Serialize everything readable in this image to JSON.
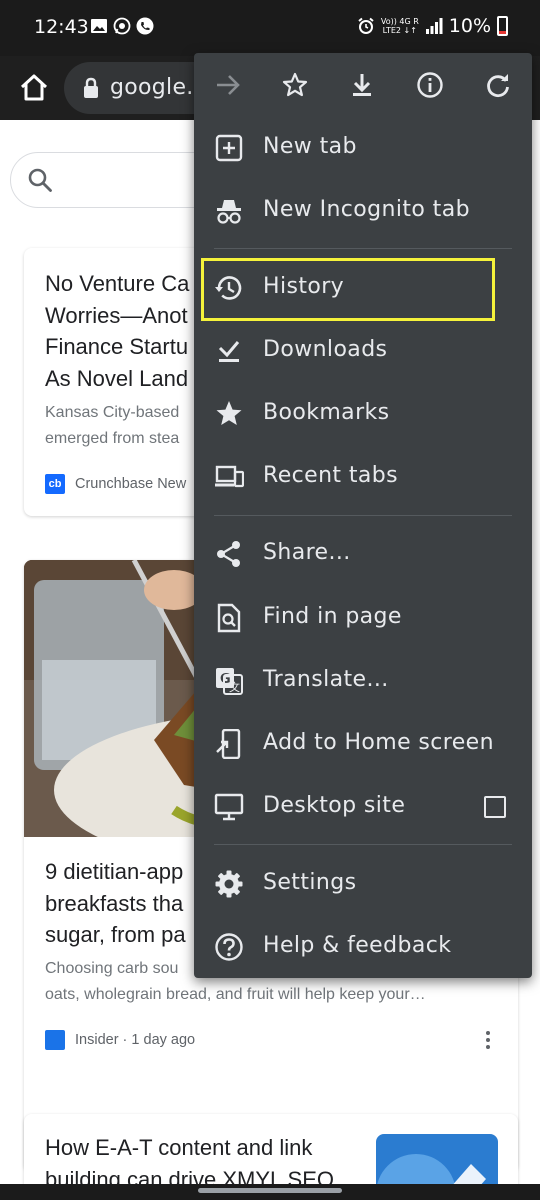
{
  "status_bar": {
    "time": "12:43",
    "network_line1": "Vo)) 4G R",
    "network_line2": "LTE2 ↓↑",
    "battery": "10%",
    "battery_color": "#e53935"
  },
  "toolbar": {
    "url": "google.c"
  },
  "menu": {
    "top_icons": [
      "forward-icon",
      "bookmark-star-icon",
      "download-icon",
      "info-icon",
      "reload-icon"
    ],
    "items": [
      {
        "label": "New tab",
        "icon": "new-tab-icon"
      },
      {
        "label": "New Incognito tab",
        "icon": "incognito-icon"
      },
      {
        "label": "History",
        "icon": "history-icon",
        "highlighted": true
      },
      {
        "label": "Downloads",
        "icon": "downloads-icon"
      },
      {
        "label": "Bookmarks",
        "icon": "bookmarks-icon"
      },
      {
        "label": "Recent tabs",
        "icon": "recent-tabs-icon"
      },
      {
        "label": "Share...",
        "icon": "share-icon"
      },
      {
        "label": "Find in page",
        "icon": "find-in-page-icon"
      },
      {
        "label": "Translate...",
        "icon": "translate-icon"
      },
      {
        "label": "Add to Home screen",
        "icon": "add-to-home-icon"
      },
      {
        "label": "Desktop site",
        "icon": "desktop-icon",
        "checked": false
      },
      {
        "label": "Settings",
        "icon": "settings-icon"
      },
      {
        "label": "Help & feedback",
        "icon": "help-icon"
      }
    ],
    "highlight_color": "#f5f23b"
  },
  "feed": {
    "cards": [
      {
        "title": "No Venture Ca\nWorries—Anot\nFinance Startu\nAs Novel Land",
        "snippet": "Kansas City-based\nemerged from stea",
        "source": "Crunchbase New",
        "source_logo": "cb"
      },
      {
        "title": "9 dietitian-app\nbreakfasts tha\nsugar, from pa",
        "snippet": "Choosing carb sou\noats, wholegrain bread, and fruit will help keep your…",
        "source": "Insider · 1 day ago"
      },
      {
        "title": "How E-A-T content and link\nbuilding can drive XMYL SEO"
      }
    ]
  }
}
